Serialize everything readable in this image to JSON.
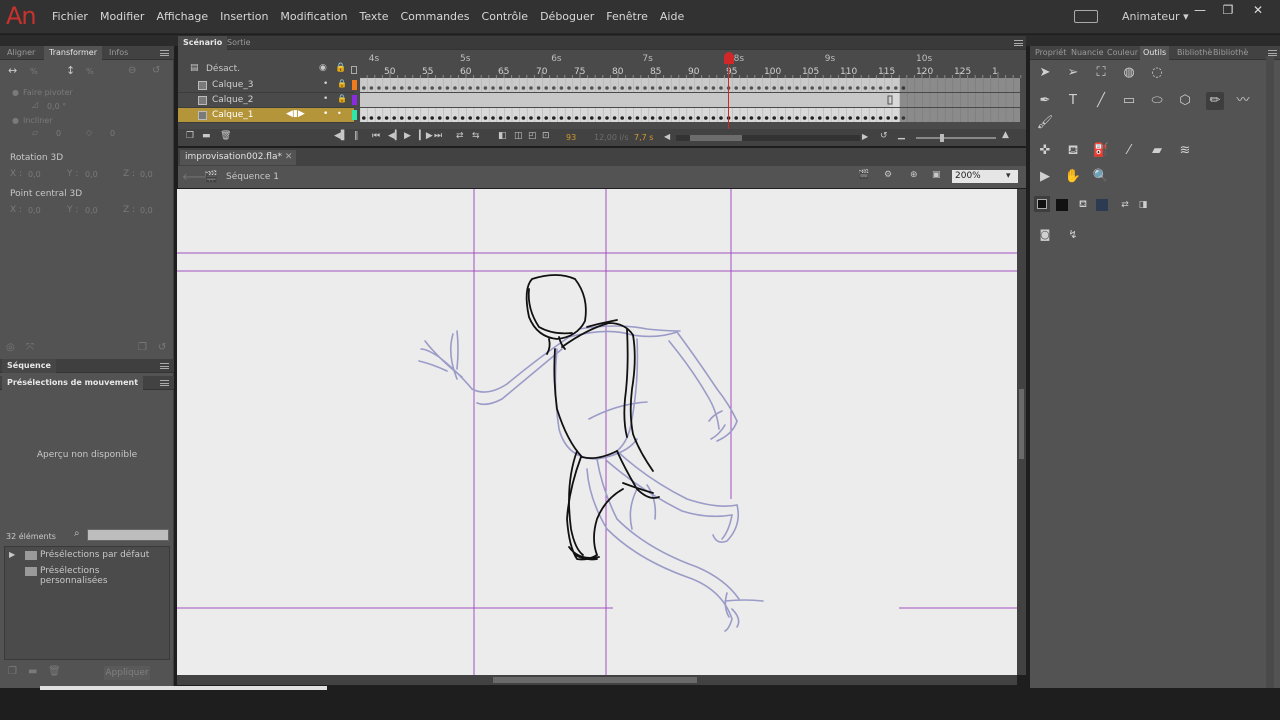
{
  "app": {
    "logo": "An",
    "menu": [
      "Fichier",
      "Modifier",
      "Affichage",
      "Insertion",
      "Modification",
      "Texte",
      "Commandes",
      "Contrôle",
      "Déboguer",
      "Fenêtre",
      "Aide"
    ],
    "workspace": "Animateur",
    "window_controls": [
      "—",
      "❐",
      "✕"
    ]
  },
  "left_panel": {
    "tabs": [
      "Aligner",
      "Transformer",
      "Infos"
    ],
    "active_tab": "Transformer",
    "rotate_label": "Faire pivoter",
    "rotate_value": "0,0 °",
    "skew_label": "Incliner",
    "skew_value_h": "0",
    "skew_value_v": "0",
    "scale_h": "%",
    "scale_v": "%",
    "rotation3d_label": "Rotation 3D",
    "rotation3d": {
      "x": "0,0",
      "y": "0,0",
      "z": "0,0"
    },
    "center3d_label": "Point central 3D",
    "center3d": {
      "x": "0,0",
      "y": "0,0",
      "z": "0,0"
    },
    "axis_x": "X :",
    "axis_y": "Y :",
    "axis_z": "Z :",
    "sequence_tab": "Séquence",
    "presets_tab": "Présélections de mouvement",
    "preview_unavailable": "Aperçu non disponible",
    "element_count": "32 éléments",
    "folders": [
      "Présélections par défaut",
      "Présélections personnalisées"
    ],
    "apply_button": "Appliquer"
  },
  "timeline": {
    "tabs": [
      "Scénario",
      "Sortie"
    ],
    "active_tab": "Scénario",
    "header_label": "Désact.",
    "seconds": [
      "4s",
      "5s",
      "6s",
      "7s",
      "8s",
      "9s",
      "10s"
    ],
    "frame_labels": [
      "50",
      "55",
      "60",
      "65",
      "70",
      "75",
      "80",
      "85",
      "90",
      "95",
      "100",
      "105",
      "110",
      "115",
      "120",
      "125",
      "1"
    ],
    "layers": [
      {
        "name": "Calque_3",
        "color": "#f07b1a",
        "selected": false
      },
      {
        "name": "Calque_2",
        "color": "#8a2be2",
        "selected": false
      },
      {
        "name": "Calque_1",
        "color": "#2ee6a8",
        "selected": true
      }
    ],
    "current_frame": "93",
    "fps": "12,00 i/s",
    "time": "7,7 s"
  },
  "stage": {
    "document_tab": "improvisation002.fla*",
    "scene": "Séquence 1",
    "zoom": "200%"
  },
  "right_panel": {
    "tabs": [
      "Propriét",
      "Nuancie",
      "Couleur",
      "Outils",
      "Bibliothè",
      "Bibliothè"
    ],
    "active_tab": "Outils"
  },
  "colors": {
    "accent": "#c8322d",
    "guide": "#a34fbf",
    "onion": "#9b9bc8",
    "stroke": "#111111",
    "playhead": "#d02828"
  }
}
